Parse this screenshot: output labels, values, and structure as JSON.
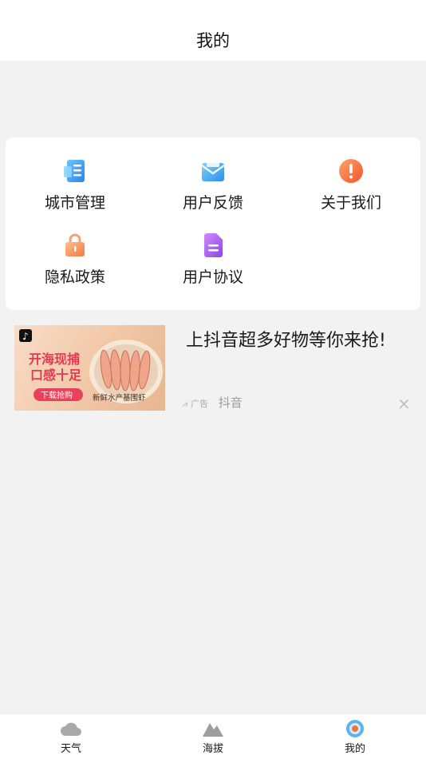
{
  "header": {
    "title": "我的"
  },
  "menu": {
    "items": [
      {
        "label": "城市管理",
        "icon": "city-list-icon"
      },
      {
        "label": "用户反馈",
        "icon": "feedback-mail-icon"
      },
      {
        "label": "关于我们",
        "icon": "about-exclamation-icon"
      },
      {
        "label": "隐私政策",
        "icon": "privacy-lock-icon"
      },
      {
        "label": "用户协议",
        "icon": "agreement-document-icon"
      }
    ]
  },
  "ad": {
    "title": "上抖音超多好物等你来抢!",
    "badge": "广告",
    "source": "抖音",
    "close": "×",
    "image_text": {
      "headline1": "开海现捕",
      "headline2": "口感十足",
      "button": "下载抢购",
      "caption": "新鲜水产基围虾"
    }
  },
  "tabbar": {
    "tabs": [
      {
        "label": "天气",
        "icon": "cloud-icon"
      },
      {
        "label": "海拔",
        "icon": "mountain-icon"
      },
      {
        "label": "我的",
        "icon": "profile-icon",
        "active": true
      }
    ]
  },
  "colors": {
    "blue": "#3a9cf0",
    "orange": "#f2733a",
    "purple": "#a45be8",
    "ad_pink": "#e8425b"
  }
}
